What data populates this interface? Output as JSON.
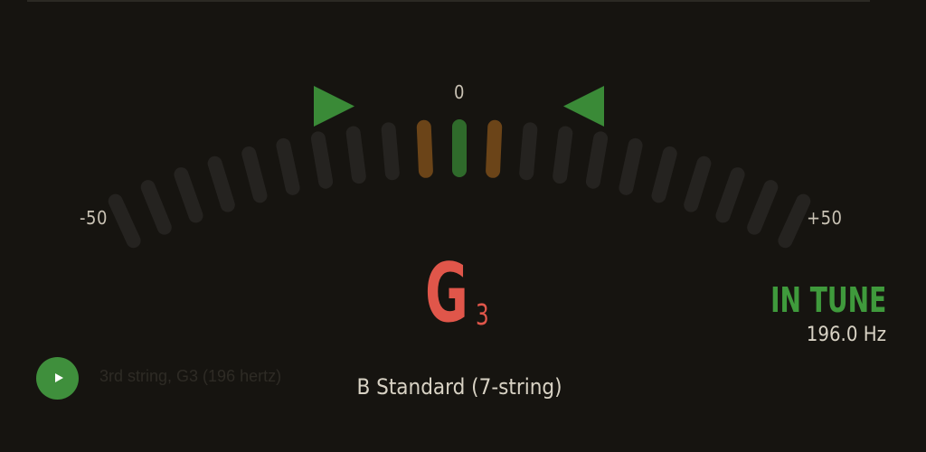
{
  "tuner": {
    "scale": {
      "center_label": "0",
      "min_label": "-50",
      "max_label": "+50",
      "segment_count": 21,
      "cents_offset": 0
    },
    "note": {
      "letter": "G",
      "octave": "3"
    },
    "status": "IN TUNE",
    "frequency": "196.0 Hz",
    "tuning": "B Standard (7-string)",
    "play": {
      "caption": "3rd string, G3 (196 hertz)",
      "icon": "play-icon"
    }
  },
  "colors": {
    "background": "#161410",
    "segment_inactive": "#252320",
    "segment_center_active": "#2f6a2b",
    "segment_neighbor_active": "#6b4418",
    "arrow": "#3a8a37",
    "note": "#e0564a",
    "status": "#3f9a3c",
    "play_button": "#3f8f3c"
  }
}
